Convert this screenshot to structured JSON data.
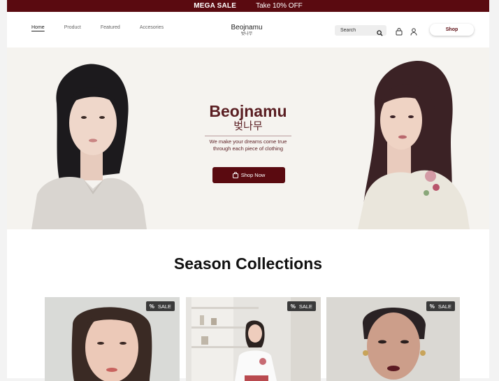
{
  "promo": {
    "sale": "MEGA SALE",
    "offer": "Take 10% OFF"
  },
  "nav": {
    "links": [
      "Home",
      "Product",
      "Featured",
      "Accesories"
    ],
    "brand_name": "Beojnamu",
    "brand_korean": "벚나무",
    "search_placeholder": "Search",
    "shop_label": "Shop"
  },
  "hero": {
    "title": "Beojnamu",
    "subtitle": "벚나무",
    "tagline_line1": "We make your dreams come true",
    "tagline_line2": "through each piece of clothing",
    "cta_label": "Shop Now"
  },
  "collections": {
    "title": "Season Collections",
    "badge_icon": "%",
    "badge_label": "SALE"
  },
  "colors": {
    "brand": "#5a0a10",
    "heading": "#5a1e22",
    "hero_bg": "#f5f3ef"
  },
  "icons": [
    "search-icon",
    "bag-icon",
    "user-icon",
    "shopping-bag-icon",
    "percent-icon"
  ]
}
